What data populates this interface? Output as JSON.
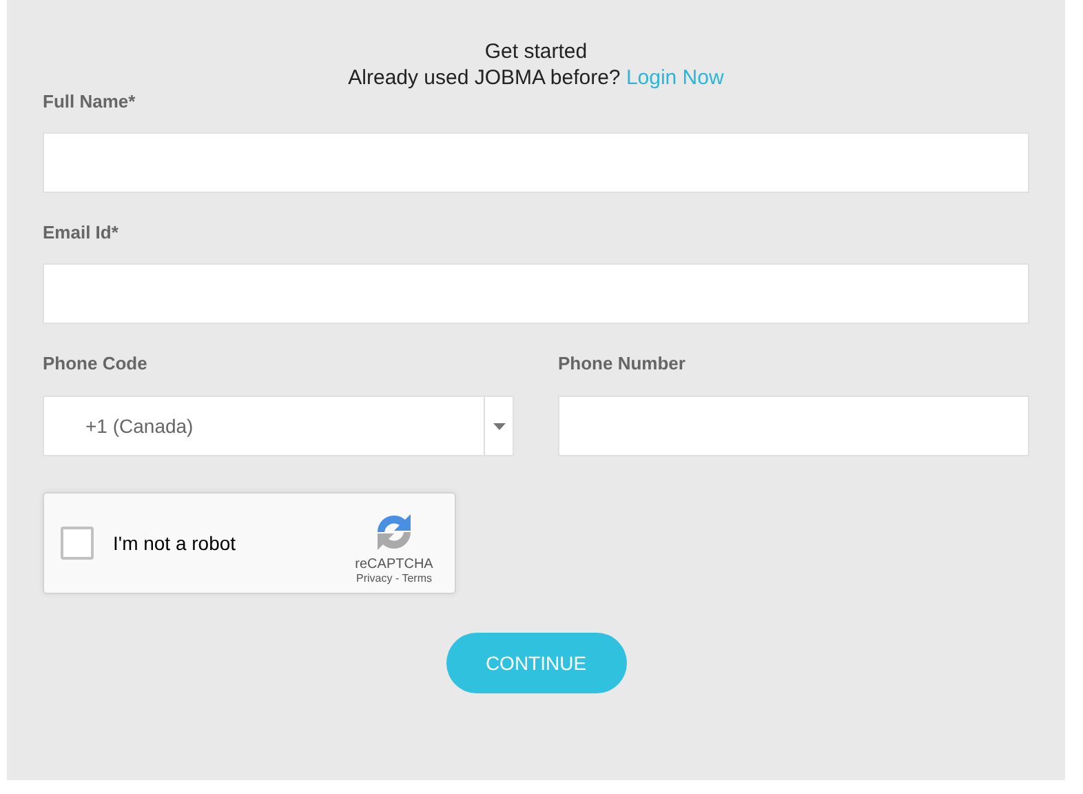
{
  "header": {
    "title": "Get started",
    "prompt": "Already used JOBMA before?",
    "login_link": "Login Now"
  },
  "fields": [
    {
      "label": "Full Name*"
    },
    {
      "label": "Email Id*"
    }
  ],
  "phone": {
    "code_label": "Phone Code",
    "code_value": "+1 (Canada)",
    "number_label": "Phone Number"
  },
  "captcha": {
    "label": "I'm not a robot",
    "checked": false,
    "brand": "reCAPTCHA",
    "privacy": "Privacy",
    "separator": "-",
    "terms": "Terms"
  },
  "submit": "CONTINUE"
}
